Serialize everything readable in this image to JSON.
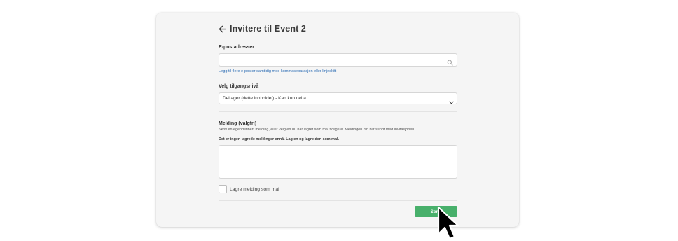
{
  "header": {
    "title": "Invitere til Event 2"
  },
  "email": {
    "label": "E-postadresser",
    "value": "",
    "hint": "Legg til flere e-poster samtidig med kommaseparasjon eller linjeskift"
  },
  "access": {
    "label": "Velg tilgangsnivå",
    "selected": "Deltager (dette innholdet) - Kan kun delta."
  },
  "message": {
    "label": "Melding (valgfri)",
    "description": "Skriv en egendefinert melding, eller velg en du har lagret som mal tidligere. Meldingen din blir sendt med invitasjonen.",
    "no_templates": "Det er ingen lagrede meldinger ennå. Lag en og lagre den som mal.",
    "value": ""
  },
  "save_template": {
    "label": "Lagre melding som mal",
    "checked": false
  },
  "actions": {
    "send_label": "Send"
  },
  "colors": {
    "accent": "#48b06b",
    "link": "#2a6bb3",
    "card_bg": "#f5f5f5"
  }
}
